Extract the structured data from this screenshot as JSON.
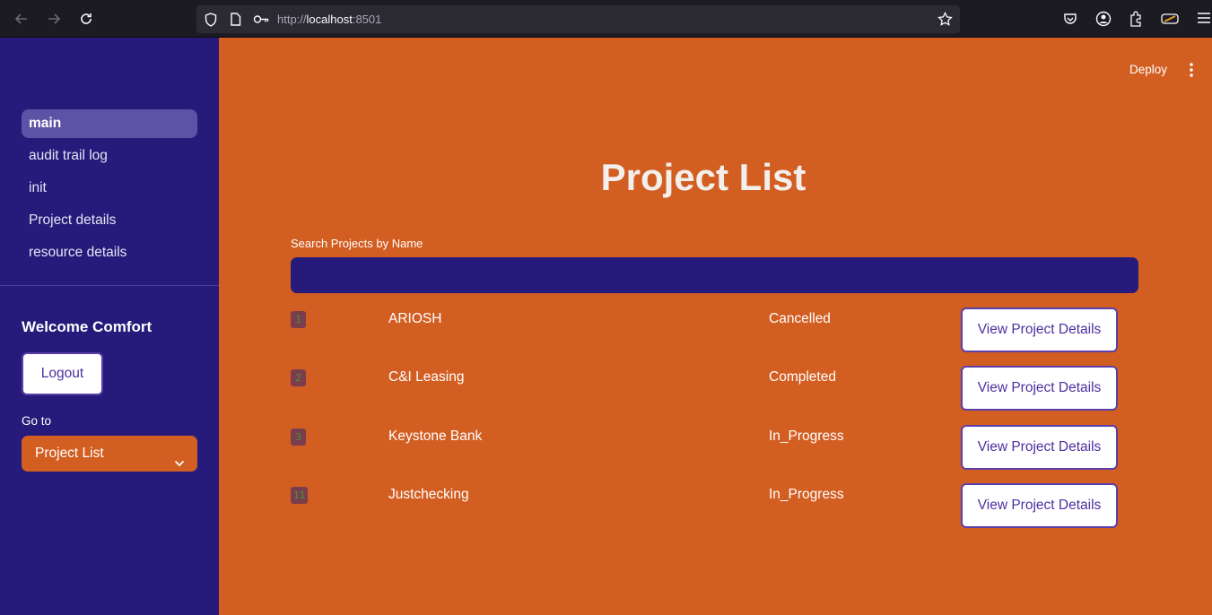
{
  "browser": {
    "url_prefix": "http://",
    "url_host": "localhost",
    "url_port": ":8501"
  },
  "sidebar": {
    "nav_items": [
      {
        "label": "main",
        "active": true
      },
      {
        "label": "audit trail log",
        "active": false
      },
      {
        "label": "init",
        "active": false
      },
      {
        "label": "Project details",
        "active": false
      },
      {
        "label": "resource details",
        "active": false
      }
    ],
    "welcome_text": "Welcome Comfort",
    "logout_label": "Logout",
    "goto_label": "Go to",
    "goto_selected": "Project List"
  },
  "header": {
    "deploy_label": "Deploy"
  },
  "main": {
    "title": "Project List",
    "search_label": "Search Projects by Name",
    "search_value": "",
    "view_button_label": "View Project Details",
    "projects": [
      {
        "id": "1",
        "name": "ARIOSH",
        "status": "Cancelled"
      },
      {
        "id": "2",
        "name": "C&I Leasing",
        "status": "Completed"
      },
      {
        "id": "3",
        "name": "Keystone Bank",
        "status": "In_Progress"
      },
      {
        "id": "11",
        "name": "Justchecking",
        "status": "In_Progress"
      }
    ]
  },
  "colors": {
    "sidebar_bg": "#261b7a",
    "main_bg": "#d35e22",
    "active_nav": "#5e52a6",
    "button_border": "#5b3fa8"
  }
}
